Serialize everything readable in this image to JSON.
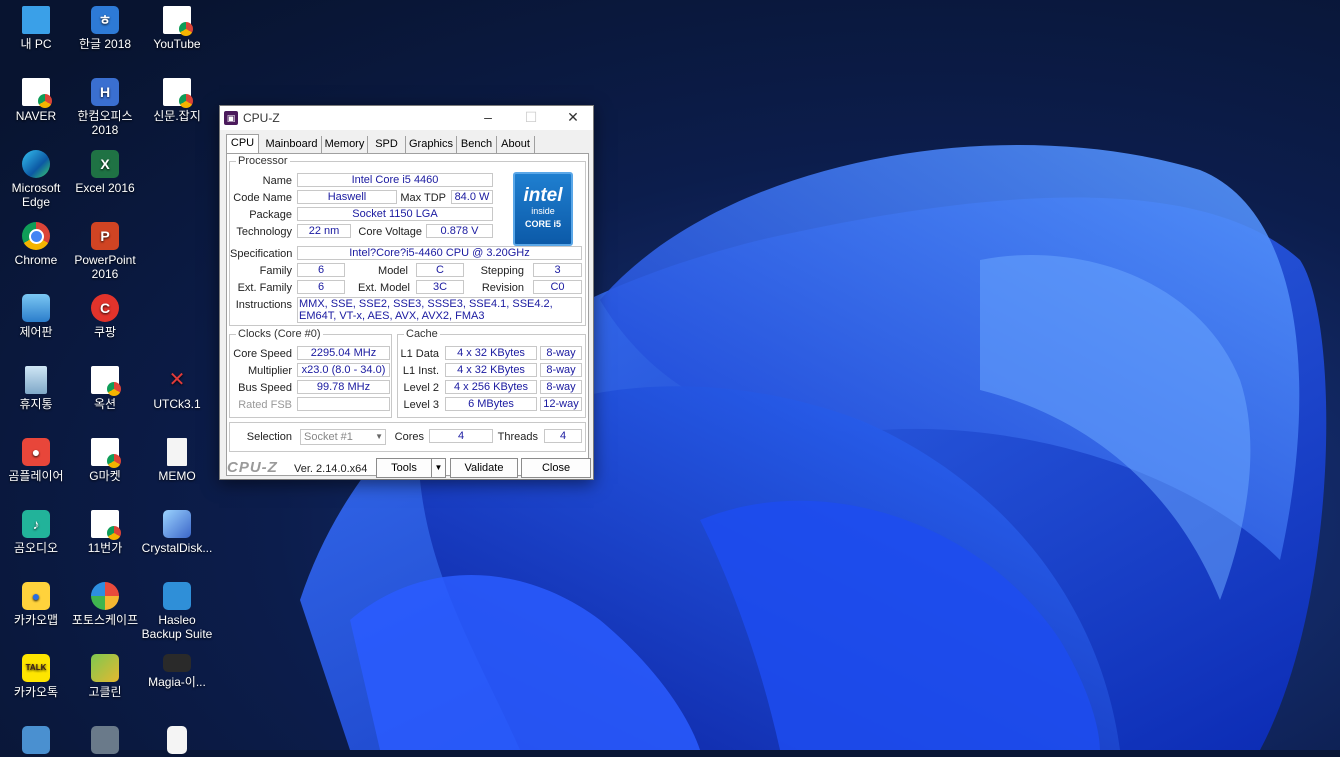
{
  "desktop": {
    "icons": [
      {
        "label": "내 PC",
        "icon": "monitor-icon"
      },
      {
        "label": "한글 2018",
        "icon": "hangul-icon"
      },
      {
        "label": "YouTube",
        "icon": "chrome-page-icon"
      },
      {
        "label": "NAVER",
        "icon": "chrome-page-icon"
      },
      {
        "label": "한컴오피스 2018",
        "icon": "hancom-office-icon"
      },
      {
        "label": "신문.잡지",
        "icon": "chrome-page-icon"
      },
      {
        "label": "Microsoft Edge",
        "icon": "edge-icon"
      },
      {
        "label": "Excel 2016",
        "icon": "excel-icon"
      },
      {
        "label": "Chrome",
        "icon": "chrome-icon"
      },
      {
        "label": "PowerPoint 2016",
        "icon": "powerpoint-icon"
      },
      {
        "label": "제어판",
        "icon": "control-panel-icon"
      },
      {
        "label": "쿠팡",
        "icon": "coupang-icon"
      },
      {
        "label": "휴지통",
        "icon": "recycle-bin-icon"
      },
      {
        "label": "옥션",
        "icon": "chrome-page-icon"
      },
      {
        "label": "UTCk3.1",
        "icon": "utck-icon"
      },
      {
        "label": "곰플레이어",
        "icon": "gom-player-icon"
      },
      {
        "label": "G마켓",
        "icon": "chrome-page-icon"
      },
      {
        "label": "MEMO",
        "icon": "text-file-icon"
      },
      {
        "label": "곰오디오",
        "icon": "gom-audio-icon"
      },
      {
        "label": "11번가",
        "icon": "chrome-page-icon"
      },
      {
        "label": "CrystalDisk...",
        "icon": "crystaldisk-icon"
      },
      {
        "label": "카카오맵",
        "icon": "kakao-map-icon"
      },
      {
        "label": "포토스케이프",
        "icon": "photoscape-icon"
      },
      {
        "label": "Hasleo Backup Suite",
        "icon": "hasleo-icon"
      },
      {
        "label": "카카오톡",
        "icon": "kakaotalk-icon"
      },
      {
        "label": "고클린",
        "icon": "goclean-icon"
      },
      {
        "label": "Magia-이...",
        "icon": "magia-icon"
      }
    ]
  },
  "window": {
    "title": "CPU-Z",
    "tabs": [
      "CPU",
      "Mainboard",
      "Memory",
      "SPD",
      "Graphics",
      "Bench",
      "About"
    ],
    "active_tab": "CPU",
    "processor": {
      "group_title": "Processor",
      "name_label": "Name",
      "name": "Intel Core i5 4460",
      "codename_label": "Code Name",
      "codename": "Haswell",
      "maxtdp_label": "Max TDP",
      "maxtdp": "84.0 W",
      "package_label": "Package",
      "package": "Socket 1150 LGA",
      "technology_label": "Technology",
      "technology": "22 nm",
      "corevoltage_label": "Core Voltage",
      "corevoltage": "0.878 V",
      "specification_label": "Specification",
      "specification": "Intel?Core?i5-4460  CPU @ 3.20GHz",
      "family_label": "Family",
      "family": "6",
      "model_label": "Model",
      "model": "C",
      "stepping_label": "Stepping",
      "stepping": "3",
      "extfamily_label": "Ext. Family",
      "extfamily": "6",
      "extmodel_label": "Ext. Model",
      "extmodel": "3C",
      "revision_label": "Revision",
      "revision": "C0",
      "instructions_label": "Instructions",
      "instructions": "MMX, SSE, SSE2, SSE3, SSSE3, SSE4.1, SSE4.2, EM64T, VT-x, AES, AVX, AVX2, FMA3",
      "logo": {
        "brand": "intel",
        "line1": "inside",
        "line2": "CORE i5"
      }
    },
    "clocks": {
      "group_title": "Clocks (Core #0)",
      "corespeed_label": "Core Speed",
      "corespeed": "2295.04 MHz",
      "multiplier_label": "Multiplier",
      "multiplier": "x23.0 (8.0 - 34.0)",
      "busspeed_label": "Bus Speed",
      "busspeed": "99.78 MHz",
      "ratedfsb_label": "Rated FSB",
      "ratedfsb": ""
    },
    "cache": {
      "group_title": "Cache",
      "l1data_label": "L1 Data",
      "l1data": "4 x 32 KBytes",
      "l1data_way": "8-way",
      "l1inst_label": "L1 Inst.",
      "l1inst": "4 x 32 KBytes",
      "l1inst_way": "8-way",
      "level2_label": "Level 2",
      "level2": "4 x 256 KBytes",
      "level2_way": "8-way",
      "level3_label": "Level 3",
      "level3": "6 MBytes",
      "level3_way": "12-way"
    },
    "selection": {
      "label": "Selection",
      "value": "Socket #1",
      "cores_label": "Cores",
      "cores": "4",
      "threads_label": "Threads",
      "threads": "4"
    },
    "footer": {
      "brand": "CPU-Z",
      "version": "Ver. 2.14.0.x64",
      "tools_label": "Tools",
      "validate_label": "Validate",
      "close_label": "Close"
    }
  }
}
